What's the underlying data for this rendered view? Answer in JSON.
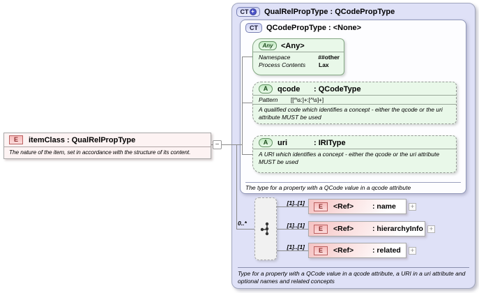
{
  "element": {
    "icon": "E",
    "title": "itemClass : QualRelPropType",
    "description": "The nature of the item, set in accordance with the structure of its content."
  },
  "outer": {
    "icon": "CT",
    "derived_badge": "+",
    "title": "QualRelPropType : QCodePropType",
    "footer": "Type for a property with a  QCode value in a qcode attribute, a URI in a uri attribute and optional names and related concepts"
  },
  "inner": {
    "icon": "CT",
    "title": "QCodePropType : <None>",
    "footer": "The type for a property with a QCode value in a qcode attribute",
    "any": {
      "icon": "Any",
      "title": "<Any>",
      "rows": [
        {
          "label": "Namespace",
          "value": "##other"
        },
        {
          "label": "Process Contents",
          "value": "Lax"
        }
      ]
    },
    "qcode": {
      "icon": "A",
      "name": "qcode",
      "type": ": QCodeType",
      "facet_label": "Pattern",
      "facet_value": "[[^\\s:]+:[^\\s]+]",
      "description": "A qualified code which identifies a concept  - either the  qcode or the uri attribute MUST be used"
    },
    "uri": {
      "icon": "A",
      "name": "uri",
      "type": ": IRIType",
      "description": "A URI which identifies a concept  - either the  qcode or the uri attribute MUST be used"
    }
  },
  "group": {
    "cardinality": "0..*",
    "refs": [
      {
        "cardinality": "[1]..[1]",
        "icon": "E",
        "label": "<Ref>",
        "name": ": name"
      },
      {
        "cardinality": "[1]..[1]",
        "icon": "E",
        "label": "<Ref>",
        "name": ": hierarchyInfo"
      },
      {
        "cardinality": "[1]..[1]",
        "icon": "E",
        "label": "<Ref>",
        "name": ": related"
      }
    ]
  },
  "toggles": {
    "collapse": "−",
    "expand": "+"
  },
  "colors": {
    "outer_fill": "#dfe1f7",
    "inner_fill": "#fdfdff",
    "attribute_fill": "#e9f8e9",
    "element_fill": "#fdf3f3",
    "ref_gradient_start": "#f5c3c3",
    "group_fill": "#f1f1f1",
    "connector_line": "#8a8a8a",
    "green_border": "#609060",
    "red_border": "#bb6060",
    "blue_border": "#7880b4"
  }
}
